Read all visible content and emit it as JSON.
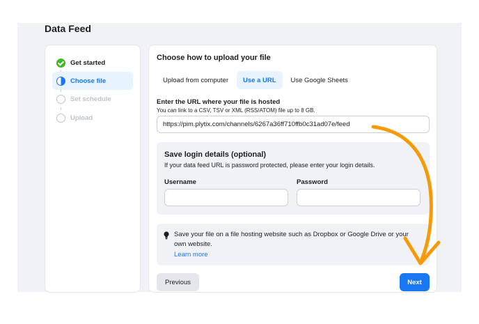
{
  "page": {
    "title": "Data Feed"
  },
  "steps": [
    {
      "label": "Get started",
      "state": "done"
    },
    {
      "label": "Choose file",
      "state": "active"
    },
    {
      "label": "Set schedule",
      "state": "pending"
    },
    {
      "label": "Upload",
      "state": "pending"
    }
  ],
  "main": {
    "heading": "Choose how to upload your file",
    "tabs": [
      {
        "label": "Upload from computer",
        "active": false
      },
      {
        "label": "Use a URL",
        "active": true
      },
      {
        "label": "Use Google Sheets",
        "active": false
      }
    ],
    "url": {
      "label": "Enter the URL where your file is hosted",
      "hint": "You can link to a CSV, TSV or XML (RSS/ATOM) file up to 8 GB.",
      "value": "https://pim.plytix.com/channels/6267a36ff710ffb0c31ad07e/feed"
    },
    "login": {
      "title": "Save login details (optional)",
      "description": "If your data feed URL is password protected, please enter your login details.",
      "username_label": "Username",
      "username_value": "",
      "password_label": "Password",
      "password_value": ""
    },
    "tip": {
      "icon": "lightbulb-icon",
      "text": "Save your file on a file hosting website such as Dropbox or Google Drive or your own website.",
      "link": "Learn more"
    },
    "buttons": {
      "previous": "Previous",
      "next": "Next"
    }
  },
  "colors": {
    "accent": "#1877f2",
    "success": "#42b72a",
    "annotation_arrow": "#f59b0a"
  }
}
